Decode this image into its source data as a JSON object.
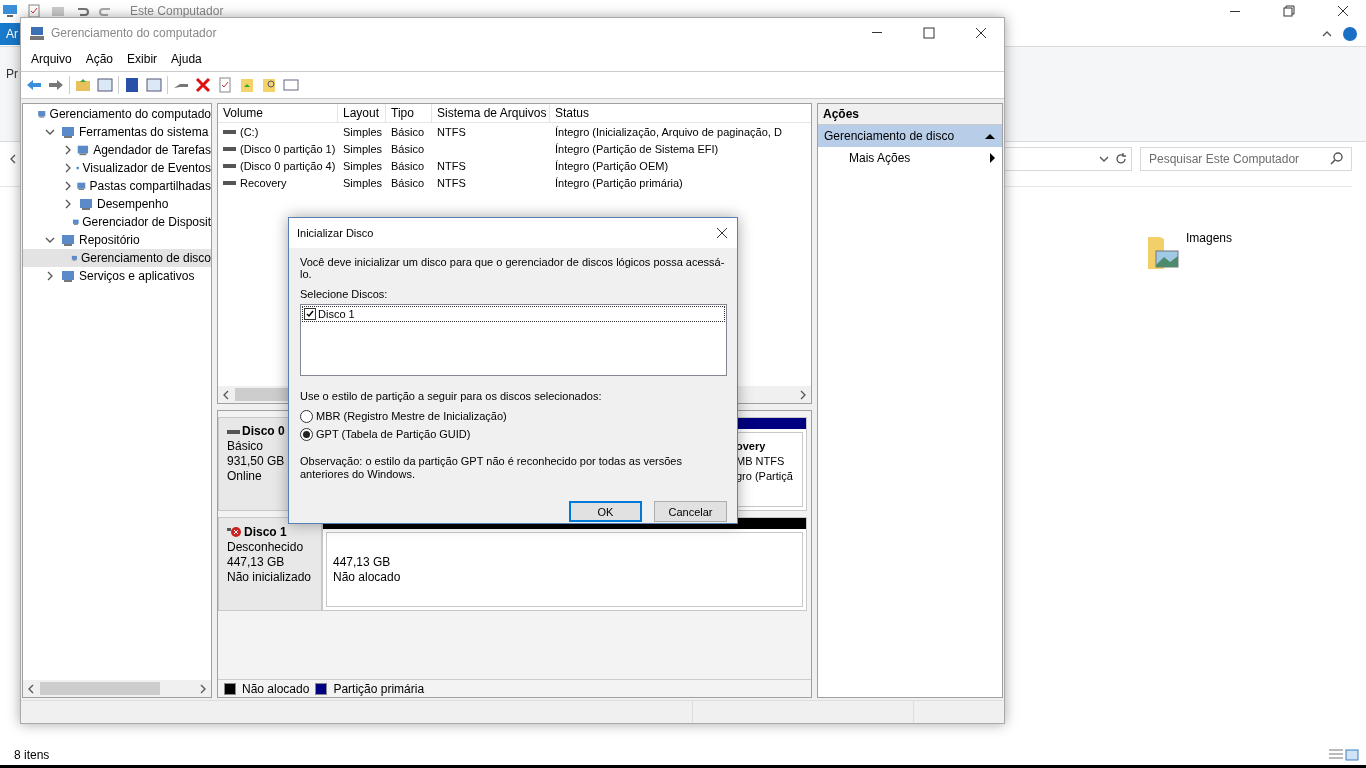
{
  "explorer": {
    "title": "Este Computador",
    "ribbon_tab": "Ar",
    "ribbon_text": "Pr",
    "search": {
      "placeholder": "Pesquisar Este Computador"
    },
    "folders": [
      {
        "label": "Imagens"
      }
    ],
    "status": "8 itens"
  },
  "window": {
    "title": "Gerenciamento do computador"
  },
  "menu": [
    "Arquivo",
    "Ação",
    "Exibir",
    "Ajuda"
  ],
  "tree": [
    {
      "label": "Gerenciamento do computado",
      "selected": false,
      "children": [
        {
          "label": "Ferramentas do sistema",
          "selected": false,
          "expanded": true,
          "children": [
            {
              "label": "Agendador de Tarefas",
              "selected": false,
              "expanded": false
            },
            {
              "label": "Visualizador de Eventos",
              "selected": false,
              "expanded": false
            },
            {
              "label": "Pastas compartilhadas",
              "selected": false,
              "expanded": false
            },
            {
              "label": "Desempenho",
              "selected": false,
              "expanded": false
            },
            {
              "label": "Gerenciador de Disposit",
              "selected": false
            }
          ]
        },
        {
          "label": "Repositório",
          "selected": false,
          "expanded": true,
          "children": [
            {
              "label": "Gerenciamento de disco",
              "selected": true
            }
          ]
        },
        {
          "label": "Serviços e aplicativos",
          "selected": false,
          "expanded": false
        }
      ]
    }
  ],
  "table": {
    "columns": [
      "Volume",
      "Layout",
      "Tipo",
      "Sistema de Arquivos",
      "Status"
    ],
    "rows": [
      [
        "(C:)",
        "Simples",
        "Básico",
        "NTFS",
        "Íntegro (Inicialização, Arquivo de paginação, D"
      ],
      [
        "(Disco 0 partição 1)",
        "Simples",
        "Básico",
        "",
        "Íntegro (Partição de Sistema EFI)"
      ],
      [
        "(Disco 0 partição 4)",
        "Simples",
        "Básico",
        "NTFS",
        "Íntegro (Partição OEM)"
      ],
      [
        "Recovery",
        "Simples",
        "Básico",
        "NTFS",
        "Íntegro (Partição primária)"
      ]
    ]
  },
  "disks": [
    {
      "name": "Disco 0",
      "kind": "online",
      "lines": [
        "Básico",
        "931,50 GB",
        "Online"
      ],
      "partitions": [
        {
          "title": "overy",
          "lines": [
            "MB NTFS",
            "gro (Partiçã"
          ],
          "color": "#000080"
        }
      ]
    },
    {
      "name": "Disco 1",
      "kind": "error",
      "lines": [
        "Desconhecido",
        "447,13 GB",
        "Não inicializado"
      ],
      "partitions": [
        {
          "lines": [
            "447,13 GB",
            "Não alocado"
          ],
          "color": "#000000"
        }
      ]
    }
  ],
  "legend": [
    {
      "label": "Não alocado",
      "color": "#000000"
    },
    {
      "label": "Partição primária",
      "color": "#000080"
    }
  ],
  "actions": {
    "title": "Ações",
    "section": "Gerenciamento de disco",
    "items": [
      "Mais Ações"
    ]
  },
  "dialog": {
    "title": "Inicializar Disco",
    "intro": "Você deve inicializar um disco para que o gerenciador de discos lógicos possa acessá-lo.",
    "list_label": "Selecione Discos:",
    "disks": [
      {
        "label": "Disco 1",
        "checked": true
      }
    ],
    "style_label": "Use o estilo de partição a seguir para os discos selecionados:",
    "options": [
      {
        "label": "MBR (Registro Mestre de Inicialização)",
        "selected": false
      },
      {
        "label": "GPT (Tabela de Partição GUID)",
        "selected": true
      }
    ],
    "note": "Observação: o estilo da partição GPT não é reconhecido por todas as versões anteriores do Windows.",
    "buttons": [
      {
        "label": "OK",
        "default": true
      },
      {
        "label": "Cancelar",
        "default": false
      }
    ]
  }
}
